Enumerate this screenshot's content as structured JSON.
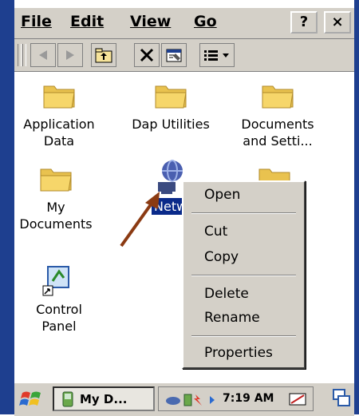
{
  "menubar": {
    "file": "File",
    "edit": "Edit",
    "view": "View",
    "go": "Go",
    "help": "?",
    "close": "×"
  },
  "content": {
    "items": [
      {
        "label": "Application\nData",
        "icon": "folder-icon"
      },
      {
        "label": "Dap Utilities",
        "icon": "folder-icon"
      },
      {
        "label": "Documents\nand Setti...",
        "icon": "folder-icon"
      },
      {
        "label": "My\nDocuments",
        "icon": "folder-icon"
      },
      {
        "label": "Netw",
        "icon": "network-icon"
      },
      {
        "label": "Control\nPanel",
        "icon": "control-panel-icon"
      }
    ]
  },
  "context_menu": {
    "items": [
      "Open",
      "Cut",
      "Copy",
      "Delete",
      "Rename",
      "Properties"
    ]
  },
  "taskbar": {
    "task_label": "My D...",
    "clock": "7:19 AM"
  },
  "colors": {
    "frame": "#1e3f8f",
    "chrome": "#d4d0c8",
    "selection": "#0a2a8a",
    "arrow": "#8b3a12",
    "folder": "#f6d66a"
  }
}
